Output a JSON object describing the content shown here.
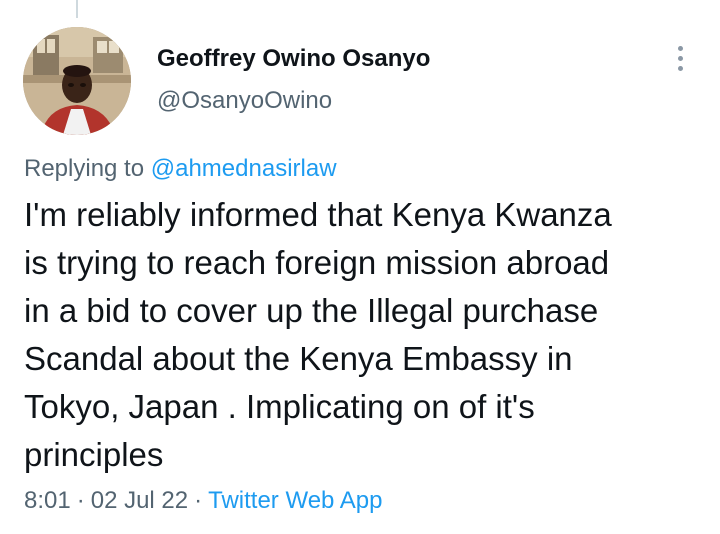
{
  "author": {
    "name": "Geoffrey Owino Osanyo",
    "handle": "@OsanyoOwino"
  },
  "reply": {
    "prefix": "Replying to",
    "target": "@ahmednasirlaw"
  },
  "tweet": {
    "text": "I'm reliably informed that Kenya Kwanza\nis trying to reach foreign mission abroad\nin a bid to cover up the Illegal purchase\nScandal about the Kenya Embassy in\nTokyo, Japan . Implicating on of it's\nprinciples"
  },
  "meta": {
    "time": "8:01",
    "separator": "·",
    "date": "02 Jul 22",
    "source": "Twitter Web App"
  },
  "icons": {
    "more": "more-vertical-icon",
    "avatar": "profile-photo"
  },
  "colors": {
    "link": "#1d9bf0",
    "secondary_text": "#536471",
    "primary_text": "#0f1419",
    "background": "#ffffff"
  }
}
